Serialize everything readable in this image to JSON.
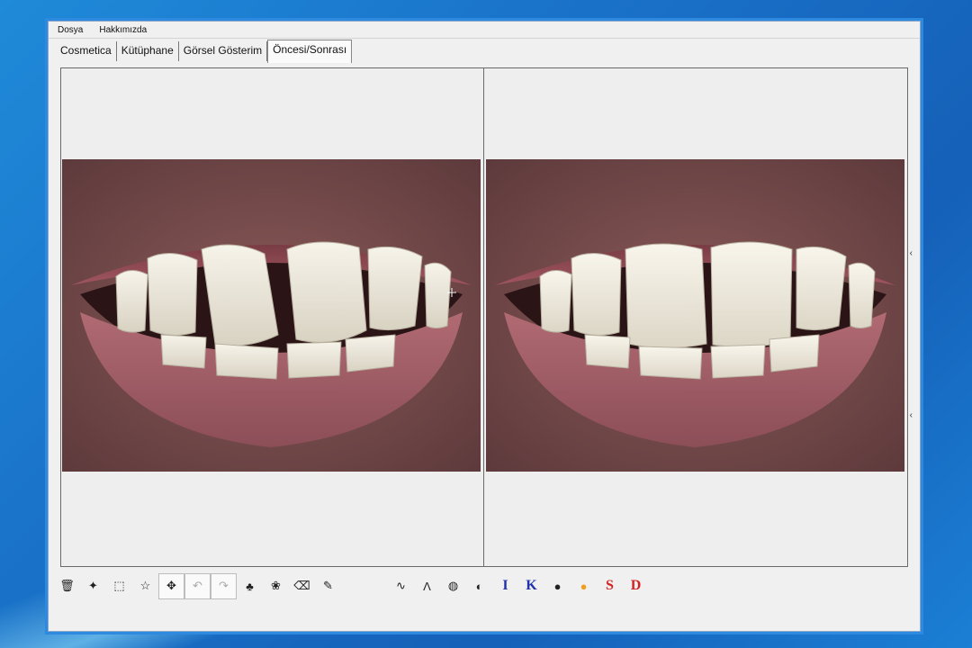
{
  "menu": {
    "items": [
      "Dosya",
      "Hakkımızda"
    ]
  },
  "tabs": [
    {
      "label": "Cosmetica"
    },
    {
      "label": "Kütüphane"
    },
    {
      "label": "Görsel Gösterim"
    },
    {
      "label": "Öncesi/Sonrası",
      "active": true
    }
  ],
  "panels": {
    "before": {
      "image": "teeth-before-photo"
    },
    "after": {
      "image": "teeth-after-photo"
    }
  },
  "toolbar": {
    "letters": {
      "i": "I",
      "k": "K",
      "s": "S",
      "d": "D"
    },
    "colors": {
      "i": "#2233aa",
      "k": "#2233aa",
      "s": "#d22222",
      "d": "#d22222",
      "orange_dot": "#f0a020"
    }
  }
}
